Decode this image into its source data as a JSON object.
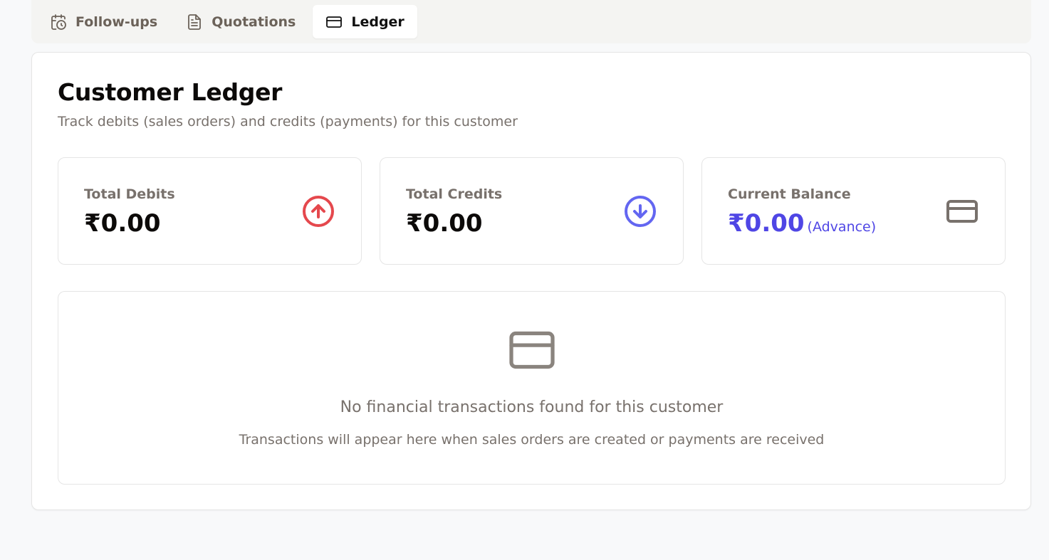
{
  "tabs": [
    {
      "label": "Follow-ups",
      "icon": "calendar-clock-icon"
    },
    {
      "label": "Quotations",
      "icon": "file-text-icon"
    },
    {
      "label": "Ledger",
      "icon": "credit-card-icon"
    }
  ],
  "active_tab": "Ledger",
  "ledger": {
    "title": "Customer Ledger",
    "subtitle": "Track debits (sales orders) and credits (payments) for this customer"
  },
  "stats": {
    "debits": {
      "label": "Total Debits",
      "value": "₹0.00",
      "icon": "arrow-up-circle-icon",
      "color": "#e5484d"
    },
    "credits": {
      "label": "Total Credits",
      "value": "₹0.00",
      "icon": "arrow-down-circle-icon",
      "color": "#6366f1"
    },
    "balance": {
      "label": "Current Balance",
      "value": "₹0.00",
      "note": "(Advance)",
      "icon": "credit-card-icon",
      "color": "#4f46e5"
    }
  },
  "empty_state": {
    "icon": "credit-card-icon",
    "title": "No financial transactions found for this customer",
    "description": "Transactions will appear here when sales orders are created or payments are received"
  }
}
